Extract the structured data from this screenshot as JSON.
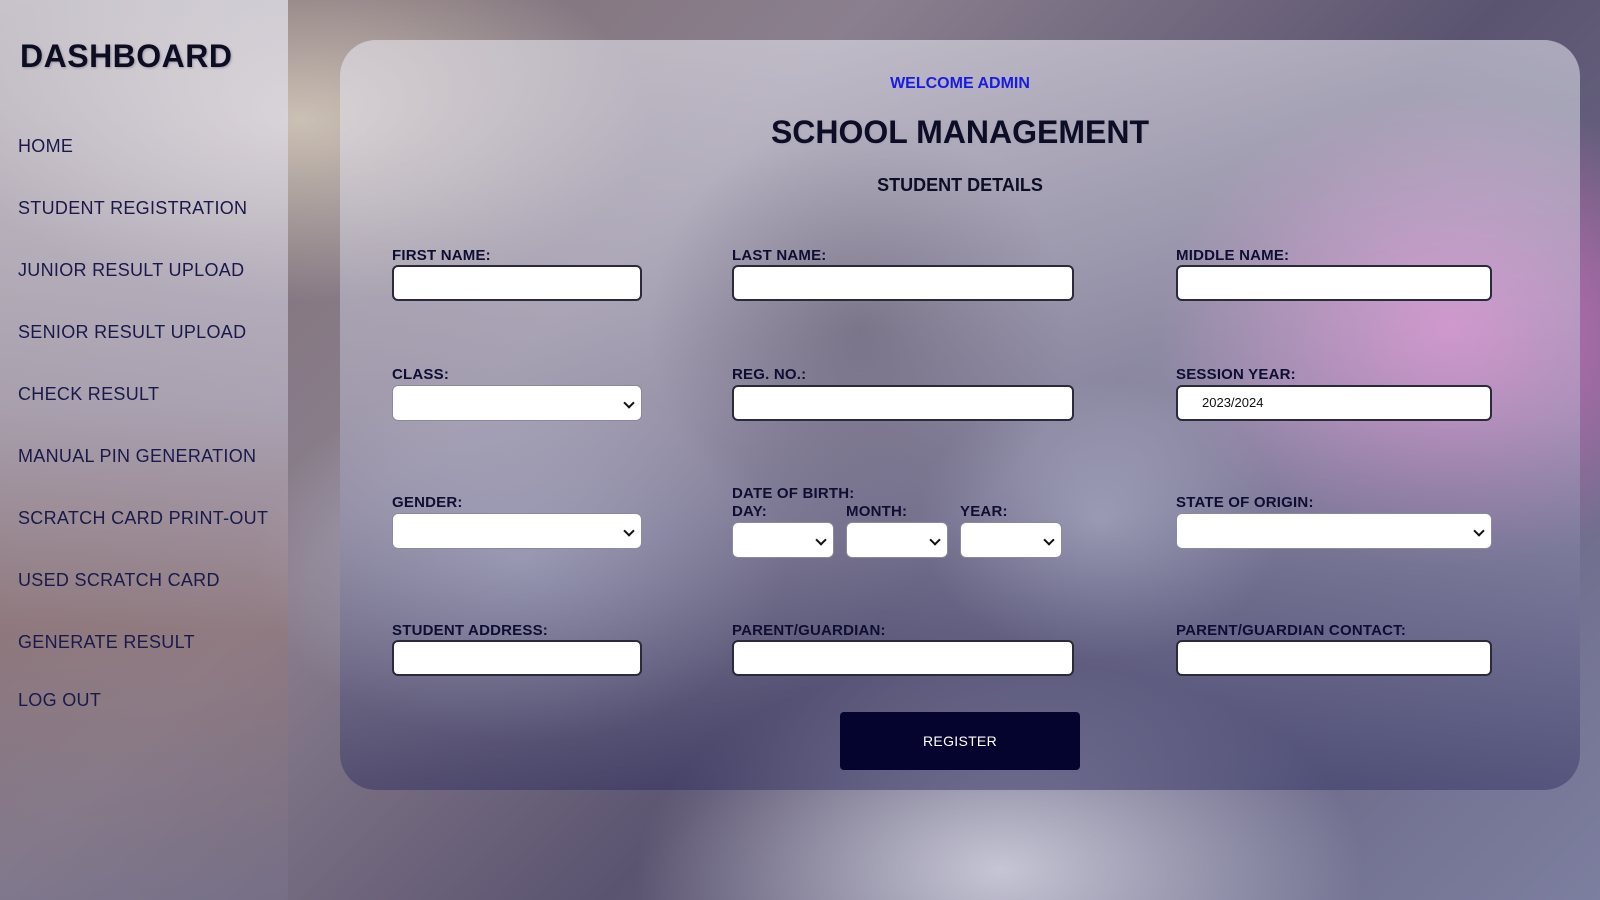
{
  "sidebar": {
    "title": "DASHBOARD",
    "items": [
      {
        "label": "HOME"
      },
      {
        "label": "STUDENT REGISTRATION"
      },
      {
        "label": "JUNIOR RESULT UPLOAD"
      },
      {
        "label": "SENIOR RESULT UPLOAD"
      },
      {
        "label": "CHECK RESULT"
      },
      {
        "label": "MANUAL PIN GENERATION"
      },
      {
        "label": "SCRATCH CARD PRINT-OUT"
      },
      {
        "label": "USED SCRATCH CARD"
      },
      {
        "label": "GENERATE RESULT"
      },
      {
        "label": "LOG OUT"
      }
    ]
  },
  "header": {
    "welcome": "WELCOME ADMIN",
    "title": "SCHOOL MANAGEMENT",
    "subtitle": "STUDENT DETAILS"
  },
  "form": {
    "first_name": {
      "label": "FIRST NAME:",
      "value": ""
    },
    "last_name": {
      "label": "LAST NAME:",
      "value": ""
    },
    "middle_name": {
      "label": "MIDDLE NAME:",
      "value": ""
    },
    "class": {
      "label": "CLASS:",
      "value": ""
    },
    "reg_no": {
      "label": "REG. NO.:",
      "value": ""
    },
    "session_year": {
      "label": "SESSION YEAR:",
      "value": "2023/2024"
    },
    "gender": {
      "label": "GENDER:",
      "value": ""
    },
    "dob": {
      "label": "DATE OF BIRTH:",
      "day_label": "DAY:",
      "month_label": "MONTH:",
      "year_label": "YEAR:"
    },
    "state_of_origin": {
      "label": "STATE OF ORIGIN:",
      "value": ""
    },
    "student_address": {
      "label": "STUDENT ADDRESS:",
      "value": ""
    },
    "parent_guardian": {
      "label": "PARENT/GUARDIAN:",
      "value": ""
    },
    "parent_contact": {
      "label": "PARENT/GUARDIAN CONTACT:",
      "value": ""
    },
    "register_label": "REGISTER"
  },
  "colors": {
    "welcome": "#1a1ae6",
    "register_button": "#04042e",
    "text_dark": "#0e0e33"
  }
}
